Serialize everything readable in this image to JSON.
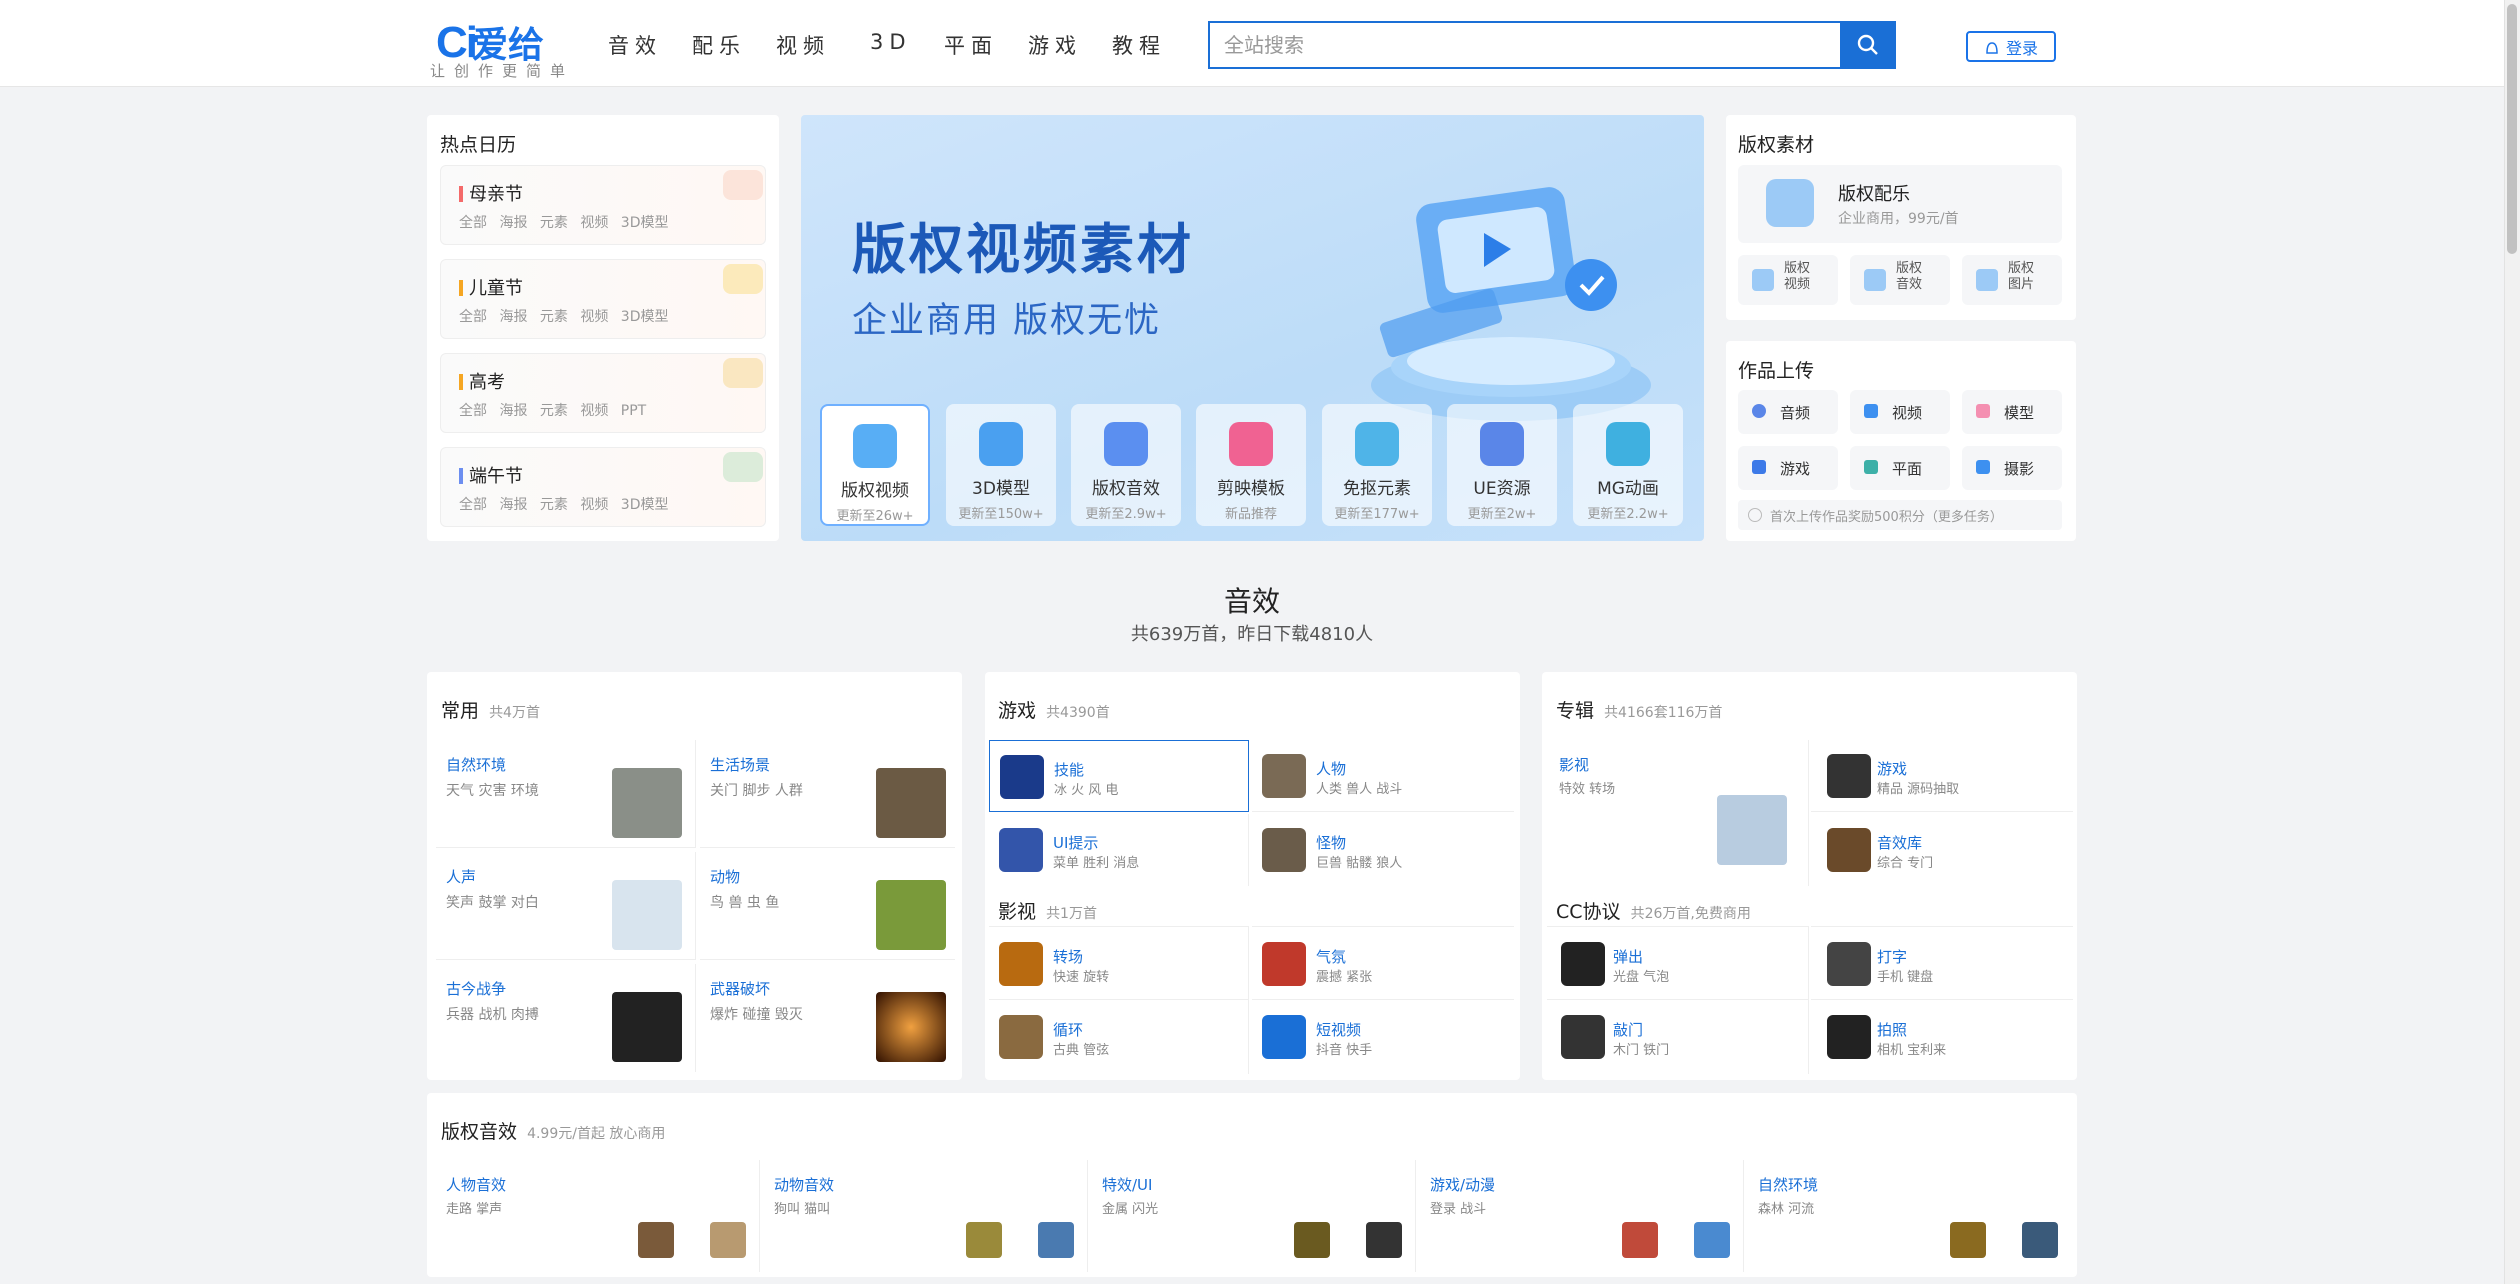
{
  "header": {
    "logo_mark": "Ci",
    "logo_name": "爱给",
    "slogan": "让创作更简单",
    "nav": [
      "音效",
      "配乐",
      "视频",
      "3D",
      "平面",
      "游戏",
      "教程"
    ],
    "search_placeholder": "全站搜索",
    "login": "登录"
  },
  "calendar": {
    "title": "热点日历",
    "items": [
      {
        "name": "母亲节",
        "tags": "全部 海报 元素 视频 3D模型",
        "color": "#f46a6a"
      },
      {
        "name": "儿童节",
        "tags": "全部 海报 元素 视频 3D模型",
        "color": "#f5a623"
      },
      {
        "name": "高考",
        "tags": "全部 海报 元素 视频 PPT",
        "color": "#f5a623"
      },
      {
        "name": "端午节",
        "tags": "全部 海报 元素 视频 3D模型",
        "color": "#6c8ef0"
      }
    ]
  },
  "banner": {
    "title": "版权视频素材",
    "subtitle": "企业商用  版权无忧",
    "cards": [
      {
        "label": "版权视频",
        "sub": "更新至26w+",
        "color": "#58aef5"
      },
      {
        "label": "3D模型",
        "sub": "更新至150w+",
        "color": "#4aa0f0"
      },
      {
        "label": "版权音效",
        "sub": "更新至2.9w+",
        "color": "#5b8ff0"
      },
      {
        "label": "剪映模板",
        "sub": "新品推荐",
        "color": "#f06292"
      },
      {
        "label": "免抠元素",
        "sub": "更新至177w+",
        "color": "#4fb4e8"
      },
      {
        "label": "UE资源",
        "sub": "更新至2w+",
        "color": "#5a86e8"
      },
      {
        "label": "MG动画",
        "sub": "更新至2.2w+",
        "color": "#3fb0e0"
      }
    ]
  },
  "copyright": {
    "title": "版权素材",
    "feature_title": "版权配乐",
    "feature_sub": "企业商用，99元/首",
    "subs": [
      "版权视频",
      "版权音效",
      "版权图片"
    ]
  },
  "upload": {
    "title": "作品上传",
    "items": [
      "音频",
      "视频",
      "模型",
      "游戏",
      "平面",
      "摄影"
    ],
    "hint": "首次上传作品奖励500积分（更多任务）"
  },
  "sound": {
    "title": "音效",
    "subtitle": "共639万首，昨日下载4810人"
  },
  "common": {
    "title": "常用",
    "count": "共4万首",
    "cells": [
      {
        "t": "自然环境",
        "s": "天气 灾害 环境",
        "c": "#8a8f88"
      },
      {
        "t": "生活场景",
        "s": "关门 脚步 人群",
        "c": "#6b5a44"
      },
      {
        "t": "人声",
        "s": "笑声 鼓掌 对白",
        "c": "#d8e4ee"
      },
      {
        "t": "动物",
        "s": "鸟 兽 虫 鱼",
        "c": "#7a9a3a"
      },
      {
        "t": "古今战争",
        "s": "兵器 战机 肉搏",
        "c": "#222"
      },
      {
        "t": "武器破坏",
        "s": "爆炸 碰撞 毁灭",
        "c": "#a04010"
      }
    ]
  },
  "game": {
    "title": "游戏",
    "count": "共4390首",
    "cells": [
      {
        "t": "技能",
        "s": "冰 火 风 电",
        "c": "#1a3a8a"
      },
      {
        "t": "人物",
        "s": "人类 兽人 战斗",
        "c": "#7a6a55"
      },
      {
        "t": "UI提示",
        "s": "菜单 胜利 消息",
        "c": "#3355aa"
      },
      {
        "t": "怪物",
        "s": "巨兽 骷髅 狼人",
        "c": "#6a5c4a"
      }
    ]
  },
  "film": {
    "title": "影视",
    "count": "共1万首",
    "cells": [
      {
        "t": "转场",
        "s": "快速 旋转",
        "c": "#b86a10"
      },
      {
        "t": "气氛",
        "s": "震撼 紧张",
        "c": "#c0392b"
      },
      {
        "t": "循环",
        "s": "古典 管弦",
        "c": "#8a6a40"
      },
      {
        "t": "短视频",
        "s": "抖音 快手",
        "c": "#1a6fd6"
      }
    ]
  },
  "album": {
    "title": "专辑",
    "count": "共4166套116万首",
    "cells": [
      {
        "t": "影视",
        "s": "特效 转场",
        "c": "#b8cce0"
      },
      {
        "t": "游戏",
        "s": "精品 源码抽取",
        "c": "#333"
      },
      {
        "t": "音效库",
        "s": "综合 专门",
        "c": "#6a4a2a"
      }
    ]
  },
  "cc": {
    "title": "CC协议",
    "count": "共26万首,免费商用",
    "cells": [
      {
        "t": "弹出",
        "s": "光盘 气泡",
        "c": "#222"
      },
      {
        "t": "打字",
        "s": "手机 键盘",
        "c": "#444"
      },
      {
        "t": "敲门",
        "s": "木门 铁门",
        "c": "#333"
      },
      {
        "t": "拍照",
        "s": "相机 宝利来",
        "c": "#222"
      }
    ]
  },
  "paid": {
    "title": "版权音效",
    "count": "4.99元/首起 放心商用",
    "cells": [
      {
        "t": "人物音效",
        "s": "走路 掌声",
        "c1": "#7a5a3a",
        "c2": "#b89a70"
      },
      {
        "t": "动物音效",
        "s": "狗叫 猫叫",
        "c1": "#9a8a3a",
        "c2": "#4a7ab0"
      },
      {
        "t": "特效/UI",
        "s": "金属 闪光",
        "c1": "#6a5a20",
        "c2": "#333"
      },
      {
        "t": "游戏/动漫",
        "s": "登录 战斗",
        "c1": "#c04a3a",
        "c2": "#4a8ad0"
      },
      {
        "t": "自然环境",
        "s": "森林 河流",
        "c1": "#8a6a20",
        "c2": "#3a5a7a"
      }
    ]
  }
}
